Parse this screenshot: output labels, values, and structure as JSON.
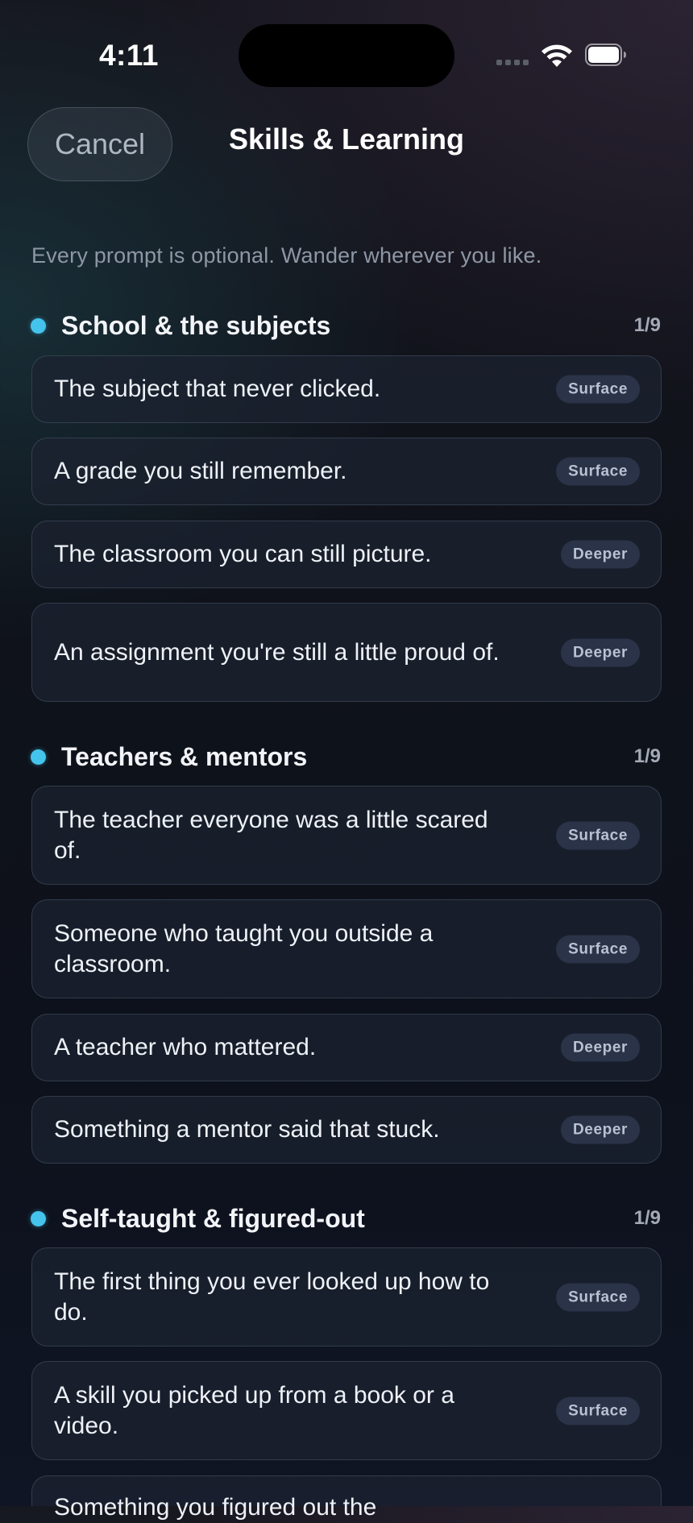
{
  "status": {
    "time": "4:11"
  },
  "header": {
    "cancel_label": "Cancel",
    "title": "Skills & Learning"
  },
  "intro": "Every prompt is optional. Wander wherever you like.",
  "sections": [
    {
      "title": "School & the subjects",
      "count": "1/9",
      "prompts": [
        {
          "text": "The subject that never clicked.",
          "depth": "Surface"
        },
        {
          "text": "A grade you still remember.",
          "depth": "Surface"
        },
        {
          "text": "The classroom you can still picture.",
          "depth": "Deeper"
        },
        {
          "text": "An assignment you're still a little proud of.",
          "depth": "Deeper"
        }
      ]
    },
    {
      "title": "Teachers & mentors",
      "count": "1/9",
      "prompts": [
        {
          "text": "The teacher everyone was a little scared of.",
          "depth": "Surface"
        },
        {
          "text": "Someone who taught you outside a classroom.",
          "depth": "Surface"
        },
        {
          "text": "A teacher who mattered.",
          "depth": "Deeper"
        },
        {
          "text": "Something a mentor said that stuck.",
          "depth": "Deeper"
        }
      ]
    },
    {
      "title": "Self-taught & figured-out",
      "count": "1/9",
      "prompts": [
        {
          "text": "The first thing you ever looked up how to do.",
          "depth": "Surface"
        },
        {
          "text": "A skill you picked up from a book or a video.",
          "depth": "Surface"
        },
        {
          "text": "Something you figured out the",
          "depth": ""
        }
      ]
    }
  ],
  "colors": {
    "accent_dot": "#44c4ec",
    "card_background": "#1c2230",
    "badge_background": "#2a3348"
  }
}
